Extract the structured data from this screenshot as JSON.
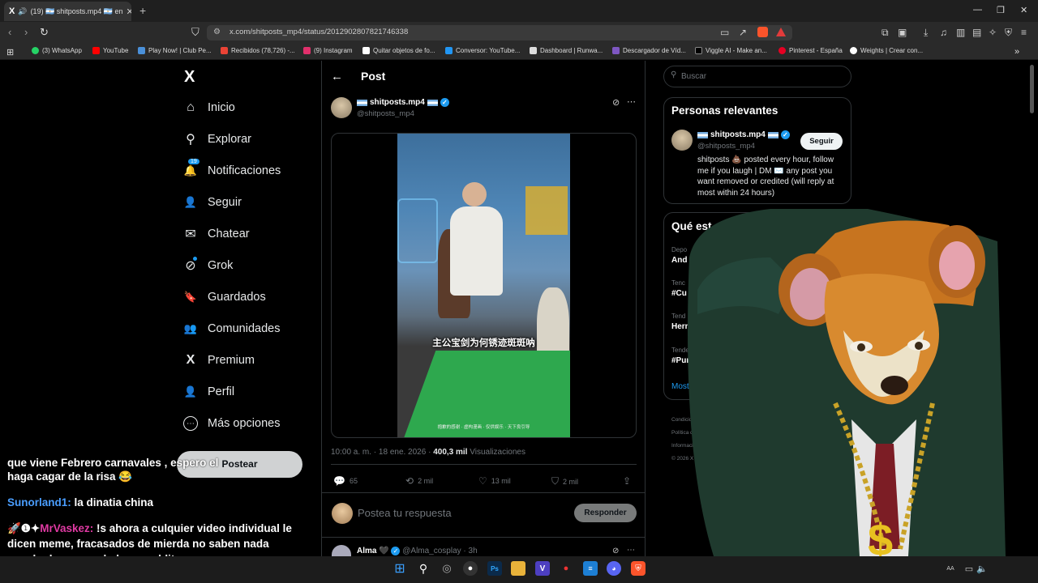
{
  "browser": {
    "tab": {
      "title": "(19) 🇦🇷 shitposts.mp4 🇦🇷 en",
      "x_label": "X"
    },
    "url": "x.com/shitposts_mp4/status/2012902807821746338",
    "bookmarks": [
      {
        "label": "(3) WhatsApp",
        "color": "#25d366"
      },
      {
        "label": "YouTube",
        "color": "#ff0000"
      },
      {
        "label": "Play Now! | Club Pe...",
        "color": "#4a90d9"
      },
      {
        "label": "Recibidos (78,726) -...",
        "color": "#ea4335"
      },
      {
        "label": "(9) Instagram",
        "color": "#e1306c"
      },
      {
        "label": "Quitar objetos de fo...",
        "color": "#ffffff"
      },
      {
        "label": "Conversor: YouTube...",
        "color": "#2196f3"
      },
      {
        "label": "Dashboard | Runwa...",
        "color": "#dddddd"
      },
      {
        "label": "Descargador de Víd...",
        "color": "#7e57c2"
      },
      {
        "label": "Viggle AI - Make an...",
        "color": "#000000"
      },
      {
        "label": "Pinterest - España",
        "color": "#e60023"
      },
      {
        "label": "Weights | Crear con...",
        "color": "#ffffff"
      }
    ]
  },
  "sidebar": {
    "logo": "X",
    "items": [
      {
        "label": "Inicio",
        "icon": "home-icon",
        "glyph": "⌂"
      },
      {
        "label": "Explorar",
        "icon": "search-icon",
        "glyph": "⚲"
      },
      {
        "label": "Notificaciones",
        "icon": "bell-icon",
        "glyph": "🔔",
        "badge": "19"
      },
      {
        "label": "Seguir",
        "icon": "add-user-icon",
        "glyph": "👤"
      },
      {
        "label": "Chatear",
        "icon": "mail-icon",
        "glyph": "✉"
      },
      {
        "label": "Grok",
        "icon": "grok-icon",
        "glyph": "⊘"
      },
      {
        "label": "Guardados",
        "icon": "bookmark-icon",
        "glyph": "🔖"
      },
      {
        "label": "Comunidades",
        "icon": "communities-icon",
        "glyph": "👥"
      },
      {
        "label": "Premium",
        "icon": "x-icon",
        "glyph": "X"
      },
      {
        "label": "Perfil",
        "icon": "profile-icon",
        "glyph": "👤"
      },
      {
        "label": "Más opciones",
        "icon": "more-icon",
        "glyph": "⋯"
      }
    ],
    "post_button": "Postear"
  },
  "post": {
    "header_title": "Post",
    "author_name": "shitposts.mp4",
    "author_handle": "@shitposts_mp4",
    "video_caption": "主公宝剑为何锈迹斑斑呐",
    "video_subtitle": "抱歉的感谢 · 虚构漫画 · 仅供娱乐 · 天下良引导",
    "meta_time": "10:00 a. m. · 18 ene. 2026 · ",
    "meta_views_count": "400,3 mil",
    "meta_views_label": " Visualizaciones",
    "stats": {
      "replies": "65",
      "reposts": "2 mil",
      "likes": "13 mil",
      "bookmarks": "2 mil"
    },
    "reply_placeholder": "Postea tu respuesta",
    "reply_button": "Responder",
    "next_reply_name": "Alma",
    "next_reply_handle": "@Alma_cosplay · 3h"
  },
  "right": {
    "search_placeholder": "Buscar",
    "relevant_title": "Personas relevantes",
    "person_name": "shitposts.mp4",
    "person_handle": "@shitposts_mp4",
    "follow_button": "Seguir",
    "person_bio": "shitposts 💩 posted every hour, follow me if you laugh | DM ✉️ any post you want removed or credited (will reply at most within 24 hours)",
    "trends_title": "Qué est",
    "trends": [
      {
        "cat": "Depo",
        "name": "And"
      },
      {
        "cat": "Tenc",
        "name": "#Cu"
      },
      {
        "cat": "Tend",
        "name": "Hern"
      },
      {
        "cat": "Tendencia",
        "name": "#Puntol"
      }
    ],
    "show_more": "Mostrar ma",
    "footer": [
      "Condiciones de Se",
      "Política de cookies",
      "Información de anu",
      "© 2026 X Corp."
    ]
  },
  "chat": {
    "line1": "que viene Febrero carnavales , espero el",
    "line1b": "haga cagar de la risa 😂",
    "user2": "Sunorland1:",
    "msg2": " la dinatia china",
    "user3": "MrVaskez:",
    "msg3": " !s ahora a culquier video individual le dicen meme, fracasados de mierda no saben nada conchadesumare, lo hare malditos"
  },
  "colors": {
    "accent": "#1d9bf0",
    "chat_user": "#4a9eff",
    "chat_user3": "#e03aa3",
    "felt": "#2ea84e"
  }
}
